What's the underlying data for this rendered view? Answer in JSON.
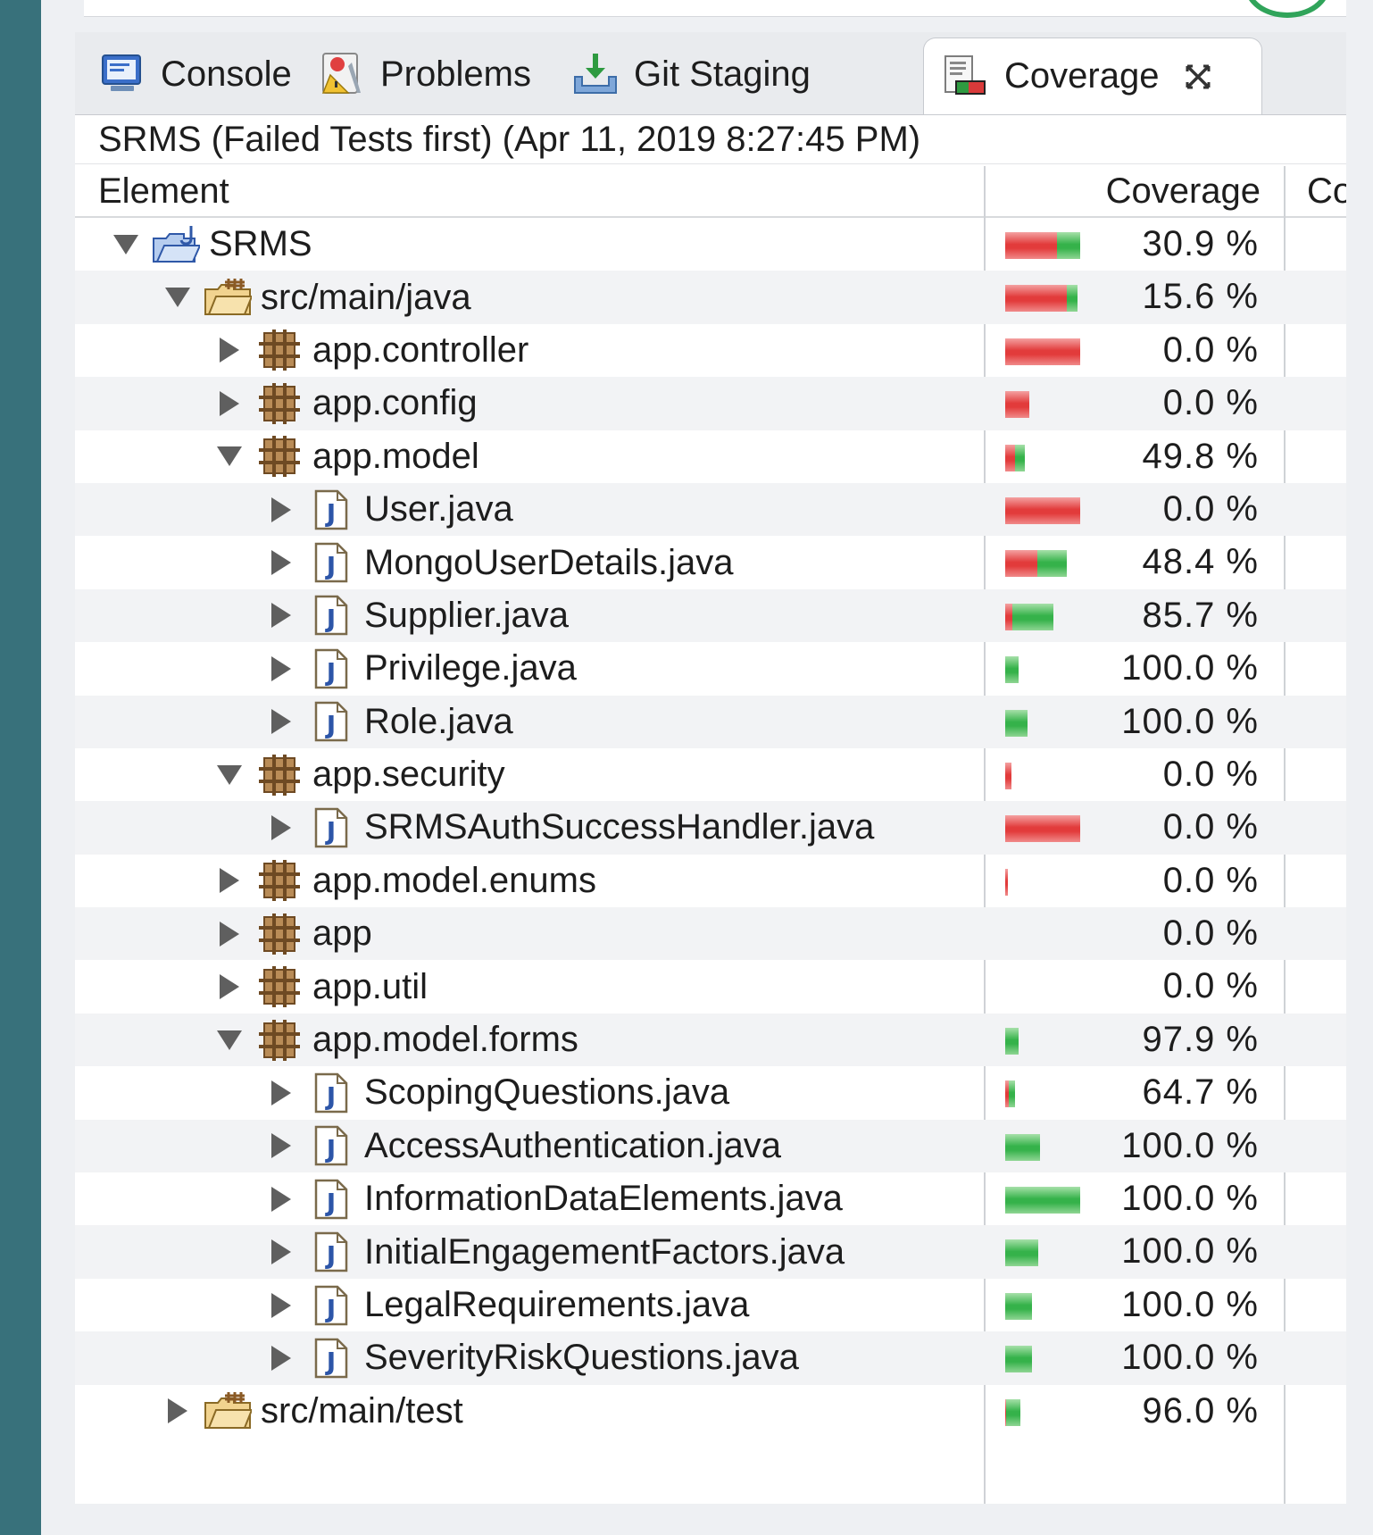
{
  "tabs": [
    {
      "label": "Console",
      "icon": "console-icon"
    },
    {
      "label": "Problems",
      "icon": "problems-icon"
    },
    {
      "label": "Git Staging",
      "icon": "git-staging-icon"
    },
    {
      "label": "Coverage",
      "icon": "coverage-icon",
      "active": true
    }
  ],
  "session_label": "SRMS (Failed Tests first) (Apr 11, 2019 8:27:45 PM)",
  "columns": {
    "element": "Element",
    "coverage": "Coverage",
    "extra": "Co"
  },
  "colors": {
    "missed": "#e23b3b",
    "covered": "#35b24a",
    "sidebar": "#38717b"
  },
  "rows": [
    {
      "name": "SRMS",
      "depth": 0,
      "expanded": true,
      "type": "project",
      "coverage": "30.9 %",
      "bar": {
        "total": 0.34,
        "covered": 0.309
      }
    },
    {
      "name": "src/main/java",
      "depth": 1,
      "expanded": true,
      "type": "folder",
      "coverage": "15.6 %",
      "bar": {
        "total": 0.33,
        "covered": 0.156
      }
    },
    {
      "name": "app.controller",
      "depth": 2,
      "expanded": false,
      "type": "package",
      "coverage": "0.0 %",
      "bar": {
        "total": 0.34,
        "covered": 0.0
      }
    },
    {
      "name": "app.config",
      "depth": 2,
      "expanded": false,
      "type": "package",
      "coverage": "0.0 %",
      "bar": {
        "total": 0.11,
        "covered": 0.0
      }
    },
    {
      "name": "app.model",
      "depth": 2,
      "expanded": true,
      "type": "package",
      "coverage": "49.8 %",
      "bar": {
        "total": 0.09,
        "covered": 0.498
      }
    },
    {
      "name": "User.java",
      "depth": 3,
      "expanded": false,
      "type": "java",
      "coverage": "0.0 %",
      "bar": {
        "total": 0.34,
        "covered": 0.0
      }
    },
    {
      "name": "MongoUserDetails.java",
      "depth": 3,
      "expanded": false,
      "type": "java",
      "coverage": "48.4 %",
      "bar": {
        "total": 0.28,
        "covered": 0.484
      }
    },
    {
      "name": "Supplier.java",
      "depth": 3,
      "expanded": false,
      "type": "java",
      "coverage": "85.7 %",
      "bar": {
        "total": 0.22,
        "covered": 0.857
      }
    },
    {
      "name": "Privilege.java",
      "depth": 3,
      "expanded": false,
      "type": "java",
      "coverage": "100.0 %",
      "bar": {
        "total": 0.06,
        "covered": 1.0
      }
    },
    {
      "name": "Role.java",
      "depth": 3,
      "expanded": false,
      "type": "java",
      "coverage": "100.0 %",
      "bar": {
        "total": 0.1,
        "covered": 1.0
      }
    },
    {
      "name": "app.security",
      "depth": 2,
      "expanded": true,
      "type": "package",
      "coverage": "0.0 %",
      "bar": {
        "total": 0.03,
        "covered": 0.0
      }
    },
    {
      "name": "SRMSAuthSuccessHandler.java",
      "depth": 3,
      "expanded": false,
      "type": "java",
      "coverage": "0.0 %",
      "bar": {
        "total": 0.34,
        "covered": 0.0
      }
    },
    {
      "name": "app.model.enums",
      "depth": 2,
      "expanded": false,
      "type": "package",
      "coverage": "0.0 %",
      "bar": {
        "total": 0.012,
        "covered": 0.0
      }
    },
    {
      "name": "app",
      "depth": 2,
      "expanded": false,
      "type": "package",
      "coverage": "0.0 %",
      "bar": {
        "total": 0.0,
        "covered": 0.0
      }
    },
    {
      "name": "app.util",
      "depth": 2,
      "expanded": false,
      "type": "package",
      "coverage": "0.0 %",
      "bar": {
        "total": 0.0,
        "covered": 0.0
      }
    },
    {
      "name": "app.model.forms",
      "depth": 2,
      "expanded": true,
      "type": "package",
      "coverage": "97.9 %",
      "bar": {
        "total": 0.06,
        "covered": 0.979
      }
    },
    {
      "name": "ScopingQuestions.java",
      "depth": 3,
      "expanded": false,
      "type": "java",
      "coverage": "64.7 %",
      "bar": {
        "total": 0.045,
        "covered": 0.647
      }
    },
    {
      "name": "AccessAuthentication.java",
      "depth": 3,
      "expanded": false,
      "type": "java",
      "coverage": "100.0 %",
      "bar": {
        "total": 0.16,
        "covered": 1.0
      }
    },
    {
      "name": "InformationDataElements.java",
      "depth": 3,
      "expanded": false,
      "type": "java",
      "coverage": "100.0 %",
      "bar": {
        "total": 0.34,
        "covered": 1.0
      }
    },
    {
      "name": "InitialEngagementFactors.java",
      "depth": 3,
      "expanded": false,
      "type": "java",
      "coverage": "100.0 %",
      "bar": {
        "total": 0.15,
        "covered": 1.0
      }
    },
    {
      "name": "LegalRequirements.java",
      "depth": 3,
      "expanded": false,
      "type": "java",
      "coverage": "100.0 %",
      "bar": {
        "total": 0.12,
        "covered": 1.0
      }
    },
    {
      "name": "SeverityRiskQuestions.java",
      "depth": 3,
      "expanded": false,
      "type": "java",
      "coverage": "100.0 %",
      "bar": {
        "total": 0.12,
        "covered": 1.0
      }
    },
    {
      "name": "src/main/test",
      "depth": 1,
      "expanded": false,
      "type": "folder",
      "coverage": "96.0 %",
      "bar": {
        "total": 0.07,
        "covered": 0.96
      }
    }
  ]
}
